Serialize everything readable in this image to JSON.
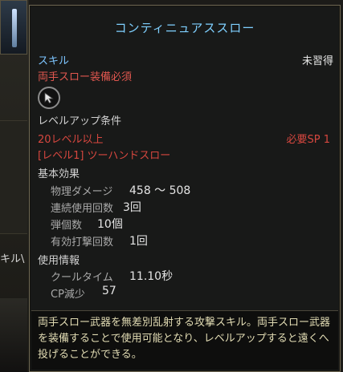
{
  "background": {
    "side_label": "キル\\"
  },
  "tooltip": {
    "title": "コンティニュアススロー",
    "skill_type": "スキル",
    "learn_status": "未習得",
    "requirement_weapon": "両手スロー装備必須",
    "skill_icon": "arrow-cursor-icon",
    "levelup": {
      "header": "レベルアップ条件",
      "level_req": "20レベル以上",
      "sp_req": "必要SP 1",
      "prereq_skill": "[レベル1] ツーハンドスロー"
    },
    "basic_effect": {
      "header": "基本効果",
      "phys_damage_label": "物理ダメージ",
      "phys_damage_value": "458 ～ 508",
      "consecutive_label": "連続使用回数",
      "consecutive_value": "3回",
      "projectiles_label": "弾個数",
      "projectiles_value": "10個",
      "hits_label": "有効打撃回数",
      "hits_value": "1回"
    },
    "usage": {
      "header": "使用情報",
      "cooldown_label": "クールタイム",
      "cooldown_value": "11.10秒",
      "cp_label": "CP減少",
      "cp_value": "57"
    },
    "description": "両手スロー武器を無差別乱射する攻撃スキル。両手スロー武器を装備することで使用可能となり、レベルアップすると遠くへ投げることができる。"
  },
  "colors": {
    "title": "#7fd0ff",
    "skill_type": "#7dc5ff",
    "requirement": "#e0574f",
    "description": "#e2dcb4"
  }
}
